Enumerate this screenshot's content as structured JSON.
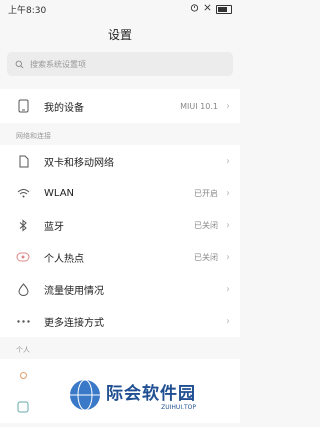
{
  "status": {
    "time": "上午8:30"
  },
  "header": {
    "title": "设置"
  },
  "search": {
    "placeholder": "搜索系统设置项"
  },
  "device": {
    "label": "我的设备",
    "value": "MIUI 10.1"
  },
  "sections": {
    "network_header": "网络和连接",
    "personal_header": "个人"
  },
  "network_items": [
    {
      "label": "双卡和移动网络",
      "value": "",
      "icon": "sim-card-icon"
    },
    {
      "label": "WLAN",
      "value": "已开启",
      "icon": "wifi-icon"
    },
    {
      "label": "蓝牙",
      "value": "已关闭",
      "icon": "bluetooth-icon"
    },
    {
      "label": "个人热点",
      "value": "已关闭",
      "icon": "hotspot-icon"
    },
    {
      "label": "流量使用情况",
      "value": "",
      "icon": "data-usage-icon"
    },
    {
      "label": "更多连接方式",
      "value": "",
      "icon": "more-dots-icon"
    }
  ],
  "watermark": {
    "main": "际会软件园",
    "sub": "ZUIHUI.TOP"
  }
}
